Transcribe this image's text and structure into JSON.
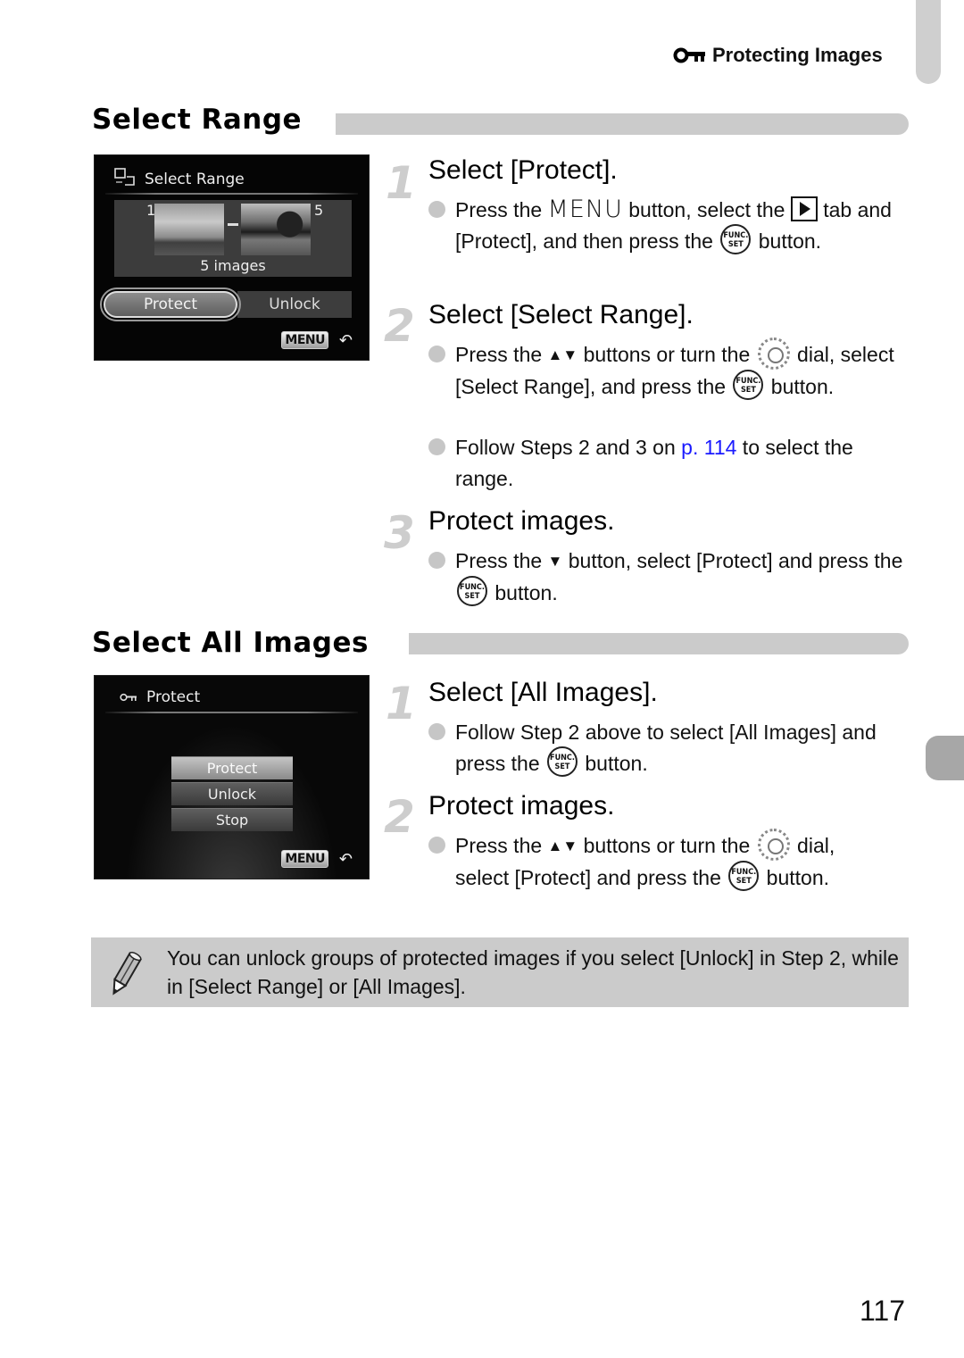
{
  "header": {
    "running_head": "Protecting Images",
    "icon": "key-icon"
  },
  "sections": {
    "select_range": {
      "title": "Select Range",
      "screen": {
        "header_icon": "select-range-icon",
        "header": "Select Range",
        "first_index": "1",
        "last_index": "5",
        "count_label": "5 images",
        "options": [
          "Protect",
          "Unlock"
        ],
        "selected": "Protect",
        "menu_label": "MENU",
        "back_icon": "return-icon"
      },
      "steps": [
        {
          "number": "1",
          "title": "Select [Protect].",
          "bullets": [
            {
              "parts": [
                "Press the ",
                "MENU",
                " button, select the ",
                "[play-tab]",
                " tab and [Protect], and then press the ",
                "[FUNC/SET]",
                " button."
              ]
            }
          ]
        },
        {
          "number": "2",
          "title": "Select [Select Range].",
          "bullets": [
            {
              "parts": [
                "Press the ",
                "▲▼",
                " buttons or turn the ",
                "[dial]",
                " dial, select [Select Range], and press the ",
                "[FUNC/SET]",
                " button."
              ]
            },
            {
              "pre": "Follow Steps 2 and 3 on ",
              "link": "p. 114",
              "post": " to select the range."
            }
          ]
        },
        {
          "number": "3",
          "title": "Protect images.",
          "bullets": [
            {
              "parts": [
                "Press the ",
                "▼",
                " button, select [Protect] and press the ",
                "[FUNC/SET]",
                " button."
              ]
            }
          ]
        }
      ]
    },
    "select_all": {
      "title": "Select All Images",
      "screen": {
        "header_icon": "key-icon",
        "header": "Protect",
        "options": [
          "Protect",
          "Unlock",
          "Stop"
        ],
        "selected": "Protect",
        "menu_label": "MENU",
        "back_icon": "return-icon"
      },
      "steps": [
        {
          "number": "1",
          "title": "Select [All Images].",
          "bullets": [
            {
              "parts": [
                "Follow Step 2 above to select [All Images] and press the ",
                "[FUNC/SET]",
                " button."
              ]
            }
          ]
        },
        {
          "number": "2",
          "title": "Protect images.",
          "bullets": [
            {
              "parts": [
                "Press the ",
                "▲▼",
                " buttons or turn the ",
                "[dial]",
                " dial, select [Protect] and press the ",
                "[FUNC/SET]",
                " button."
              ]
            }
          ]
        }
      ]
    }
  },
  "note": {
    "icon": "pencil-icon",
    "text": "You can unlock groups of protected images if you select [Unlock] in Step 2, while in [Select Range] or [All Images]."
  },
  "icons": {
    "func_set_top": "FUNC.",
    "func_set_bottom": "SET"
  },
  "page_number": "117",
  "colors": {
    "link": "#1a1aff",
    "section_bar": "#cbcbcb",
    "note_bg": "#cbcbcb",
    "step_number": "#cdcdcd"
  }
}
